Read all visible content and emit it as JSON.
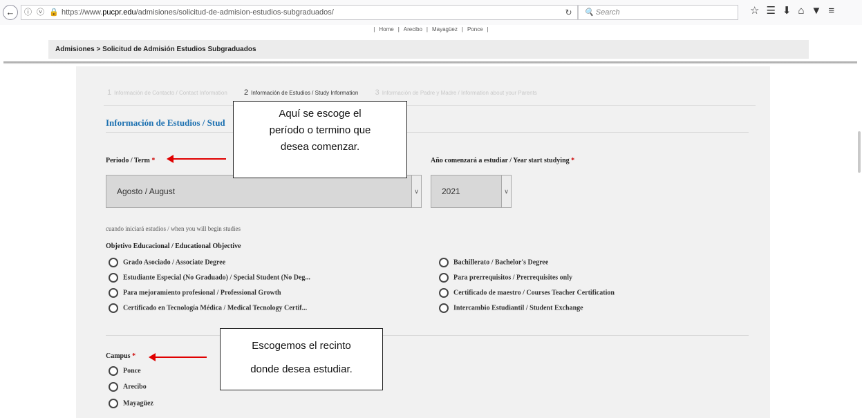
{
  "browser": {
    "url_prefix": "https://www.",
    "url_host": "pucpr.edu",
    "url_path": "/admisiones/solicitud-de-admision-estudios-subgraduados/",
    "search_placeholder": "Search"
  },
  "top_nav": {
    "items": [
      "Home",
      "Arecibo",
      "Mayagüez",
      "Ponce"
    ]
  },
  "breadcrumb": {
    "root": "Admisiones",
    "separator": ">",
    "current": "Solicitud de Admisión Estudios Subgraduados"
  },
  "steps": [
    {
      "num": "1",
      "label": "Información de Contacto / Contact Information",
      "active": false
    },
    {
      "num": "2",
      "label": "Información de Estudios / Study Information",
      "active": true
    },
    {
      "num": "3",
      "label": "Información de Padre y Madre / Information about your Parents",
      "active": false
    }
  ],
  "section_title": "Información de Estudios / Stud",
  "term": {
    "label": "Periodo / Term",
    "required": "*",
    "value": "Agosto / August"
  },
  "year": {
    "label": "Año comenzará a estudiar / Year start studying",
    "required": "*",
    "value": "2021"
  },
  "term_help": "cuando iniciará estudios / when you will begin studies",
  "objective": {
    "label": "Objetivo Educacional / Educational Objective",
    "options_left": [
      "Grado Asociado / Associate Degree",
      "Estudiante Especial (No Graduado) / Special Student (No Deg...",
      "Para mejoramiento profesional / Professional Growth",
      "Certificado en Tecnología Médica / Medical Tecnology Certif..."
    ],
    "options_right": [
      "Bachillerato / Bachelor's Degree",
      "Para prerrequisitos / Prerrequisites only",
      "Certificado de maestro / Courses Teacher Certification",
      "Intercambio Estudiantil / Student Exchange"
    ]
  },
  "campus": {
    "label": "Campus",
    "required": "*",
    "options": [
      "Ponce",
      "Arecibo",
      "Mayagüez"
    ]
  },
  "callouts": {
    "term_note": [
      "Aquí se escoge el",
      "período o termino que",
      "desea comenzar."
    ],
    "campus_note": [
      "Escogemos el recinto",
      "donde desea estudiar."
    ]
  },
  "colors": {
    "accent": "#1a6fb0",
    "required": "#cc0000",
    "arrow": "#e00000"
  }
}
